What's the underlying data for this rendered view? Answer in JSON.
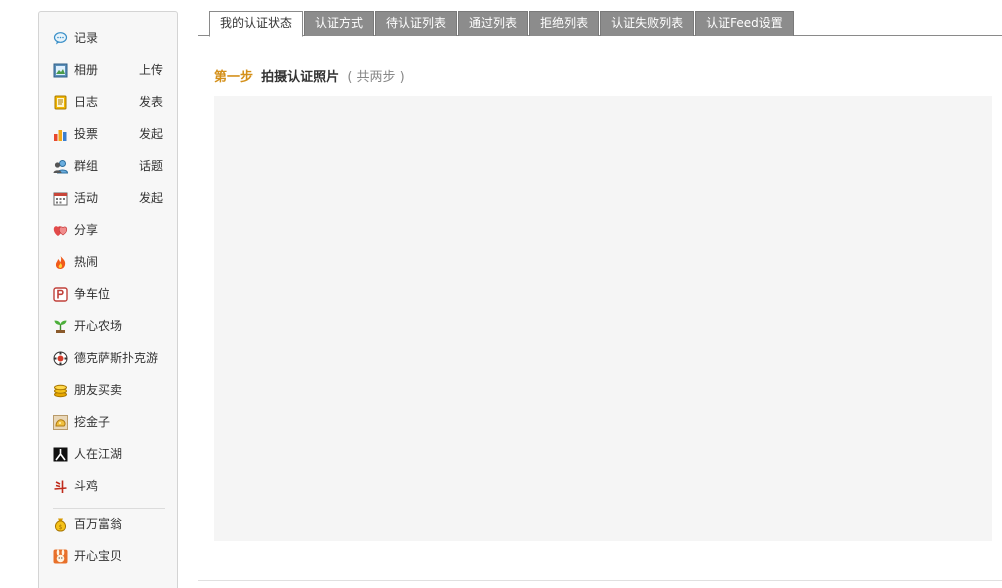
{
  "sidebar": {
    "items": [
      {
        "icon": "chat-bubble-icon",
        "label": "记录",
        "action": ""
      },
      {
        "icon": "photo-album-icon",
        "label": "相册",
        "action": "上传"
      },
      {
        "icon": "diary-icon",
        "label": "日志",
        "action": "发表"
      },
      {
        "icon": "bar-chart-icon",
        "label": "投票",
        "action": "发起"
      },
      {
        "icon": "group-people-icon",
        "label": "群组",
        "action": "话题"
      },
      {
        "icon": "calendar-icon",
        "label": "活动",
        "action": "发起"
      },
      {
        "icon": "heart-share-icon",
        "label": "分享",
        "action": ""
      },
      {
        "icon": "fire-icon",
        "label": "热闹",
        "action": ""
      },
      {
        "icon": "parking-icon",
        "label": "争车位",
        "action": ""
      },
      {
        "icon": "sprout-icon",
        "label": "开心农场",
        "action": ""
      },
      {
        "icon": "poker-chip-icon",
        "label": "德克萨斯扑克游",
        "action": ""
      },
      {
        "icon": "coin-stack-icon",
        "label": "朋友买卖",
        "action": ""
      },
      {
        "icon": "gold-nugget-icon",
        "label": "挖金子",
        "action": ""
      },
      {
        "icon": "jianghu-icon",
        "label": "人在江湖",
        "action": ""
      },
      {
        "icon": "cockfight-icon",
        "label": "斗鸡",
        "action": ""
      },
      {
        "icon": "money-bag-icon",
        "label": "百万富翁",
        "action": ""
      },
      {
        "icon": "baby-bunny-icon",
        "label": "开心宝贝",
        "action": ""
      }
    ]
  },
  "tabs": [
    {
      "label": "我的认证状态",
      "active": true
    },
    {
      "label": "认证方式",
      "active": false
    },
    {
      "label": "待认证列表",
      "active": false
    },
    {
      "label": "通过列表",
      "active": false
    },
    {
      "label": "拒绝列表",
      "active": false
    },
    {
      "label": "认证失败列表",
      "active": false
    },
    {
      "label": "认证Feed设置",
      "active": false
    }
  ],
  "main": {
    "step_number": "第一步",
    "step_title": "拍摄认证照片",
    "step_note": "( 共两步 )"
  },
  "colors": {
    "accent": "#d4901a",
    "tab_inactive": "#8c8c8c",
    "panel": "#f5f5f5"
  }
}
